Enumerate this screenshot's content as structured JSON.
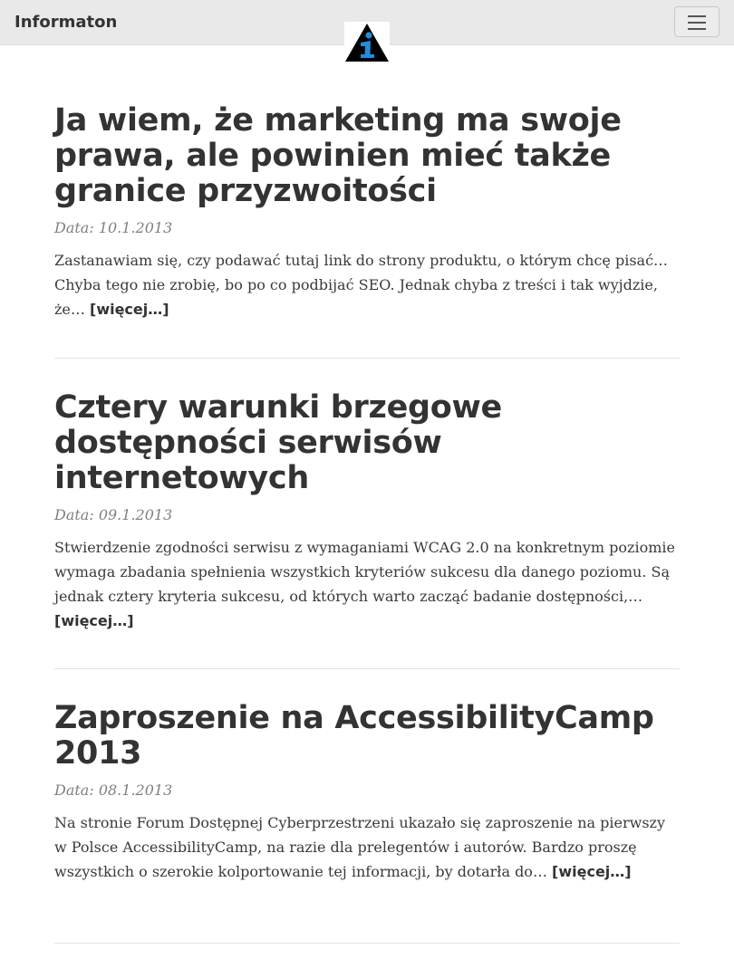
{
  "navbar": {
    "brand": "Informaton",
    "logo_icon": "info-triangle-logo",
    "toggler_icon": "hamburger-icon"
  },
  "posts": [
    {
      "title": "Ja wiem, że marketing ma swoje prawa, ale powinien mieć także granice przyzwoitości",
      "date": "Data: 10.1.2013",
      "excerpt": "Zastanawiam się, czy podawać tutaj link do strony produktu, o którym chcę pisać… Chyba tego nie zrobię, bo po co podbijać SEO. Jednak chyba z treści i tak wyjdzie, że…",
      "more": "[więcej…]"
    },
    {
      "title": "Cztery warunki brzegowe dostępności serwisów internetowych",
      "date": "Data: 09.1.2013",
      "excerpt": "Stwierdzenie zgodności serwisu z wymaganiami WCAG 2.0 na konkretnym poziomie wymaga zbadania spełnienia wszystkich kryteriów sukcesu dla danego poziomu. Są jednak cztery kryteria sukcesu, od których warto zacząć badanie dostępności,…",
      "more": "[więcej…]"
    },
    {
      "title": "Zaproszenie na AccessibilityCamp 2013",
      "date": "Data: 08.1.2013",
      "excerpt": "Na stronie Forum Dostępnej Cyberprzestrzeni ukazało się zaproszenie na pierwszy w Polsce AccessibilityCamp, na razie dla prelegentów i autorów. Bardzo proszę wszystkich o szerokie kolportowanie tej informacji, by dotarła do…",
      "more": "[więcej…]"
    }
  ],
  "colors": {
    "navbar_bg": "#e9e9e9",
    "logo_triangle": "#000000",
    "logo_accent": "#1e8fd9",
    "text": "#3a3a3a",
    "date": "#808080"
  }
}
